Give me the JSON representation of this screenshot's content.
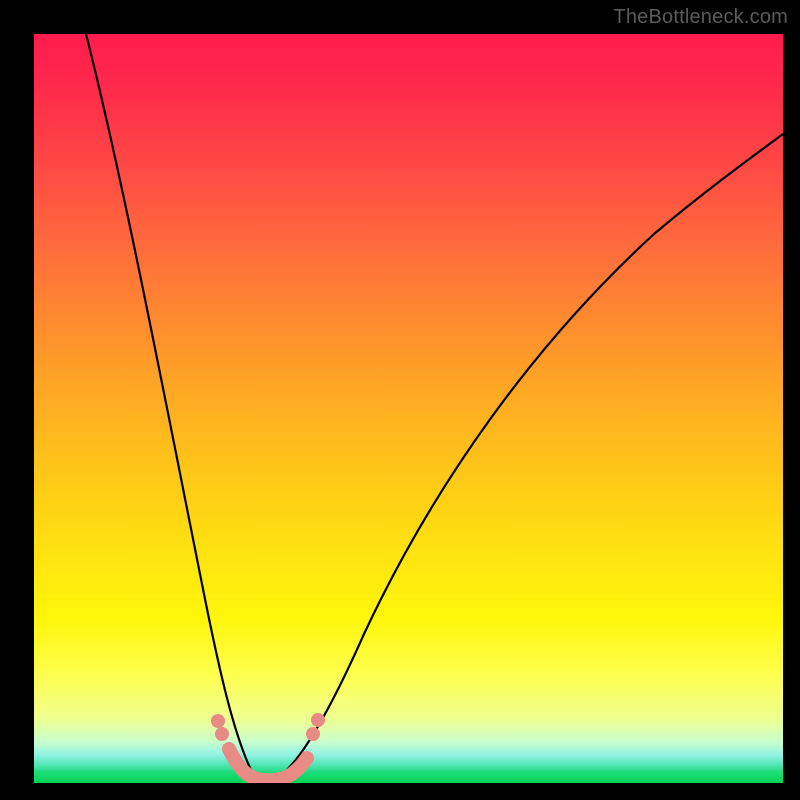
{
  "watermark": "TheBottleneck.com",
  "colors": {
    "frame": "#000000",
    "marker": "#e98b85",
    "curve": "#000000",
    "gradient_top": "#ff1b4e",
    "gradient_bottom": "#03d455"
  },
  "chart_data": {
    "type": "line",
    "title": "",
    "xlabel": "",
    "ylabel": "",
    "xlim": [
      0,
      100
    ],
    "ylim": [
      0,
      100
    ],
    "grid": false,
    "legend": false,
    "description": "Single V-shaped bottleneck curve on a vertical red-to-green gradient. Minimum (~0) occurs around x≈27–33 of the horizontal span; left branch rises steeply toward 100 at x≈7; right branch rises more gradually to ~75 at x=100.",
    "series": [
      {
        "name": "bottleneck_curve",
        "x": [
          7,
          10,
          13,
          16,
          19,
          22,
          25,
          27,
          29,
          31,
          33,
          36,
          40,
          45,
          50,
          55,
          60,
          65,
          70,
          75,
          80,
          85,
          90,
          95,
          100
        ],
        "y": [
          100,
          84,
          68,
          53,
          39,
          26,
          14,
          7,
          2,
          0,
          1,
          5,
          12,
          21,
          29,
          36,
          43,
          49,
          54,
          59,
          63,
          67,
          70,
          73,
          75
        ]
      }
    ],
    "highlight_band": {
      "description": "Salmon-colored marker segment along the valley floor near y≈0",
      "x_range": [
        25,
        36
      ],
      "y_approx": [
        4,
        0,
        4
      ]
    }
  }
}
